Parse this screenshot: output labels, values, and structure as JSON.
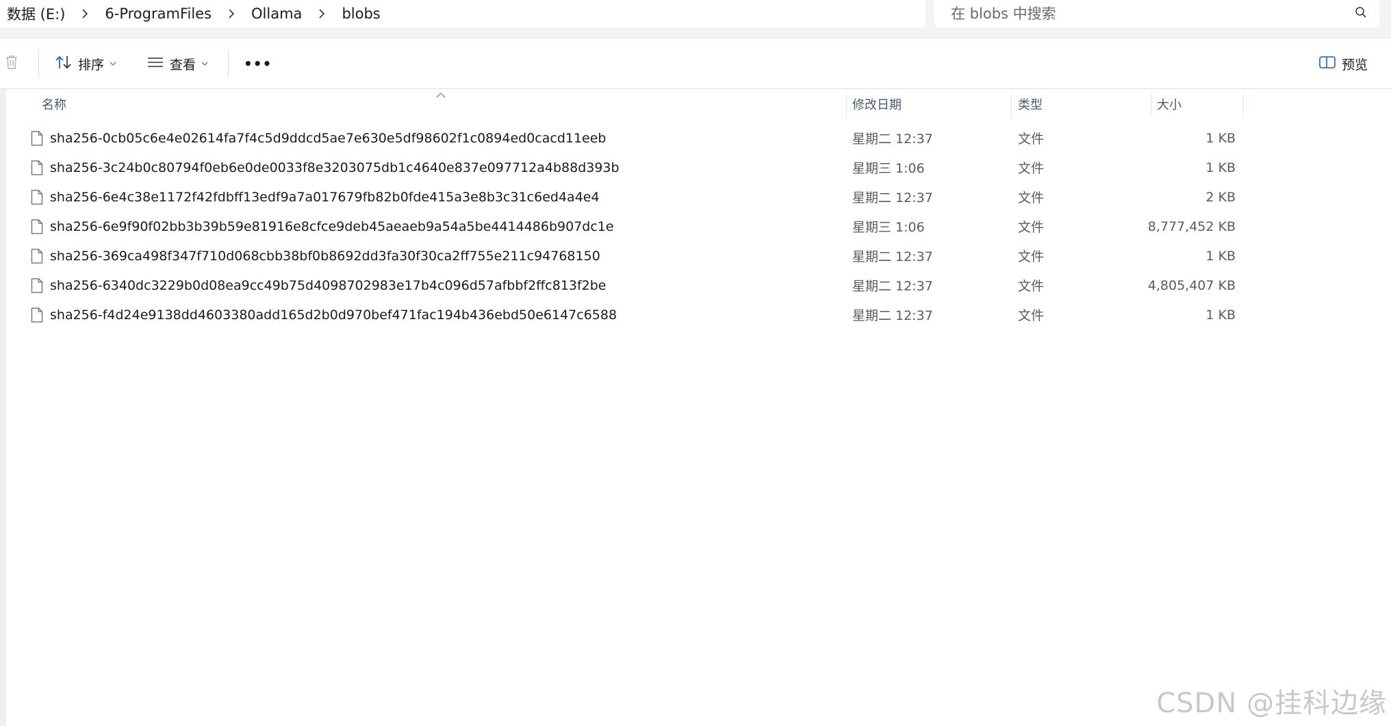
{
  "breadcrumb": {
    "items": [
      "数据 (E:)",
      "6-ProgramFiles",
      "Ollama",
      "blobs"
    ]
  },
  "search": {
    "placeholder": "在 blobs 中搜索",
    "value": ""
  },
  "commandbar": {
    "sort_label": "排序",
    "view_label": "查看",
    "more_label": "•••",
    "preview_label": "预览"
  },
  "columns": {
    "name": "名称",
    "date": "修改日期",
    "type": "类型",
    "size": "大小"
  },
  "files": [
    {
      "name": "sha256-0cb05c6e4e02614fa7f4c5d9ddcd5ae7e630e5df98602f1c0894ed0cacd11eeb",
      "date": "星期二 12:37",
      "type": "文件",
      "size": "1 KB"
    },
    {
      "name": "sha256-3c24b0c80794f0eb6e0de0033f8e3203075db1c4640e837e097712a4b88d393b",
      "date": "星期三 1:06",
      "type": "文件",
      "size": "1 KB"
    },
    {
      "name": "sha256-6e4c38e1172f42fdbff13edf9a7a017679fb82b0fde415a3e8b3c31c6ed4a4e4",
      "date": "星期二 12:37",
      "type": "文件",
      "size": "2 KB"
    },
    {
      "name": "sha256-6e9f90f02bb3b39b59e81916e8cfce9deb45aeaeb9a54a5be4414486b907dc1e",
      "date": "星期三 1:06",
      "type": "文件",
      "size": "8,777,452 KB"
    },
    {
      "name": "sha256-369ca498f347f710d068cbb38bf0b8692dd3fa30f30ca2ff755e211c94768150",
      "date": "星期二 12:37",
      "type": "文件",
      "size": "1 KB"
    },
    {
      "name": "sha256-6340dc3229b0d08ea9cc49b75d4098702983e17b4c096d57afbbf2ffc813f2be",
      "date": "星期二 12:37",
      "type": "文件",
      "size": "4,805,407 KB"
    },
    {
      "name": "sha256-f4d24e9138dd4603380add165d2b0d970bef471fac194b436ebd50e6147c6588",
      "date": "星期二 12:37",
      "type": "文件",
      "size": "1 KB"
    }
  ],
  "watermark": "CSDN @挂科边缘",
  "icons": {
    "breadcrumb_separator": "chevron-right-icon",
    "search": "search-icon",
    "delete": "trash-icon",
    "sort": "sort-arrows-icon",
    "view": "view-lines-icon",
    "more": "more-dots-icon",
    "preview": "preview-pane-icon",
    "file": "file-icon"
  },
  "colors": {
    "header_text": "#4d5a6d",
    "secondary_text": "#5b5b5b",
    "sort_icon": "#1f5fae"
  }
}
